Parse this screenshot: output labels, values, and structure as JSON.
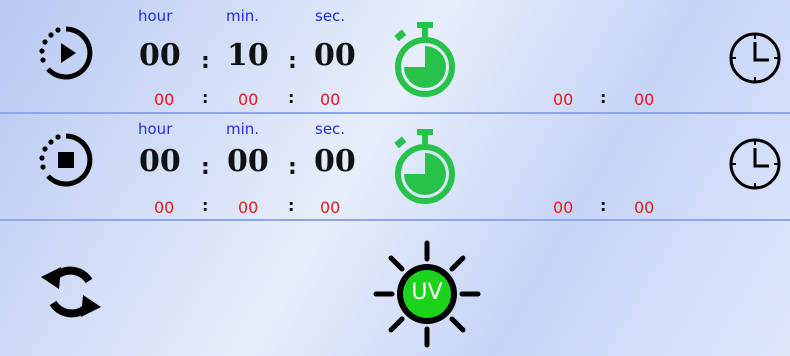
{
  "timers": [
    {
      "id": "run",
      "icon": "play-circle-icon",
      "labels": {
        "hour": "hour",
        "min": "min.",
        "sec": "sec."
      },
      "set_hours": "00",
      "set_minutes": "10",
      "set_seconds": "00",
      "sep": ":",
      "elapsed_hours": "00",
      "elapsed_minutes": "00",
      "elapsed_seconds": "00",
      "clock_hours": "00",
      "clock_minutes": "00"
    },
    {
      "id": "stop",
      "icon": "stop-circle-icon",
      "labels": {
        "hour": "hour",
        "min": "min.",
        "sec": "sec."
      },
      "set_hours": "00",
      "set_minutes": "00",
      "set_seconds": "00",
      "sep": ":",
      "elapsed_hours": "00",
      "elapsed_minutes": "00",
      "elapsed_seconds": "00",
      "clock_hours": "00",
      "clock_minutes": "00"
    }
  ],
  "bottom": {
    "refresh_icon": "refresh-icon",
    "uv_label": "UV"
  },
  "colors": {
    "label_blue": "#1f2fe0",
    "value_red": "#e81818",
    "timer_green": "#27c24a",
    "uv_green": "#1bd31b"
  }
}
